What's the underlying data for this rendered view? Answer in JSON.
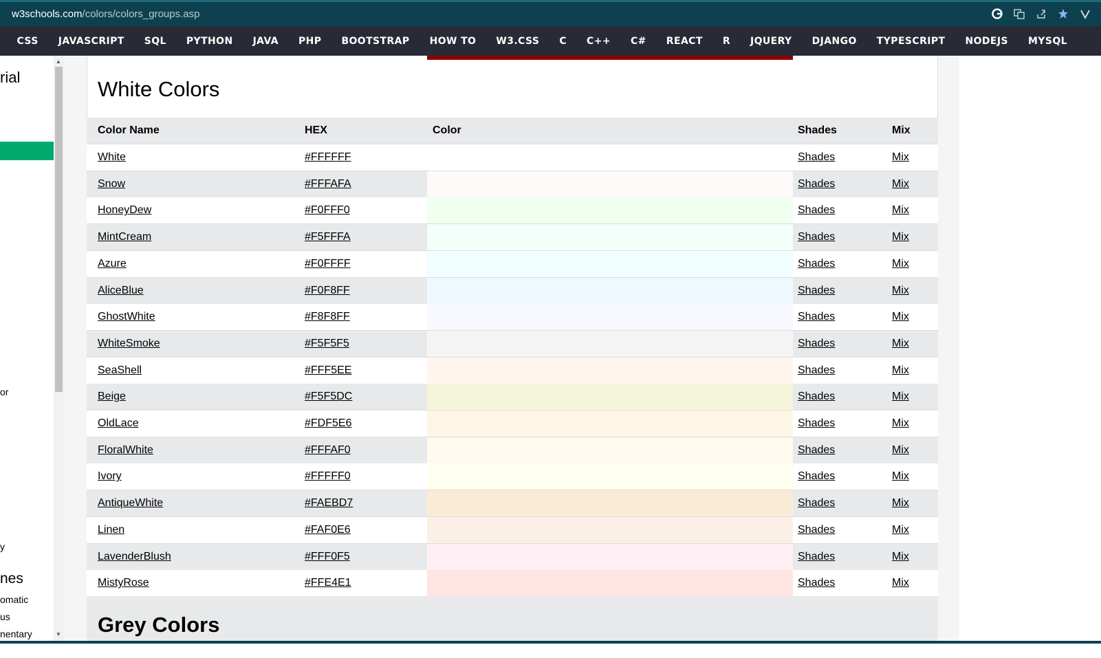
{
  "browser": {
    "url_domain": "w3schools.com",
    "url_path": "/colors/colors_groups.asp"
  },
  "topnav": {
    "items": [
      "CSS",
      "JAVASCRIPT",
      "SQL",
      "PYTHON",
      "JAVA",
      "PHP",
      "BOOTSTRAP",
      "HOW TO",
      "W3.CSS",
      "C",
      "C++",
      "C#",
      "REACT",
      "R",
      "JQUERY",
      "DJANGO",
      "TYPESCRIPT",
      "NODEJS",
      "MYSQL"
    ]
  },
  "sidebar": {
    "fragments": [
      "rial",
      "or",
      "y",
      "nes",
      "omatic",
      "us",
      "nentary"
    ]
  },
  "section": {
    "title": "White Colors",
    "next_title": "Grey Colors"
  },
  "table": {
    "headers": [
      "Color Name",
      "HEX",
      "Color",
      "Shades",
      "Mix"
    ],
    "rows": [
      {
        "name": "White",
        "hex": "#FFFFFF",
        "shades": "Shades",
        "mix": "Mix"
      },
      {
        "name": "Snow",
        "hex": "#FFFAFA",
        "shades": "Shades",
        "mix": "Mix"
      },
      {
        "name": "HoneyDew",
        "hex": "#F0FFF0",
        "shades": "Shades",
        "mix": "Mix"
      },
      {
        "name": "MintCream",
        "hex": "#F5FFFA",
        "shades": "Shades",
        "mix": "Mix"
      },
      {
        "name": "Azure",
        "hex": "#F0FFFF",
        "shades": "Shades",
        "mix": "Mix"
      },
      {
        "name": "AliceBlue",
        "hex": "#F0F8FF",
        "shades": "Shades",
        "mix": "Mix"
      },
      {
        "name": "GhostWhite",
        "hex": "#F8F8FF",
        "shades": "Shades",
        "mix": "Mix"
      },
      {
        "name": "WhiteSmoke",
        "hex": "#F5F5F5",
        "shades": "Shades",
        "mix": "Mix"
      },
      {
        "name": "SeaShell",
        "hex": "#FFF5EE",
        "shades": "Shades",
        "mix": "Mix"
      },
      {
        "name": "Beige",
        "hex": "#F5F5DC",
        "shades": "Shades",
        "mix": "Mix"
      },
      {
        "name": "OldLace",
        "hex": "#FDF5E6",
        "shades": "Shades",
        "mix": "Mix"
      },
      {
        "name": "FloralWhite",
        "hex": "#FFFAF0",
        "shades": "Shades",
        "mix": "Mix"
      },
      {
        "name": "Ivory",
        "hex": "#FFFFF0",
        "shades": "Shades",
        "mix": "Mix"
      },
      {
        "name": "AntiqueWhite",
        "hex": "#FAEBD7",
        "shades": "Shades",
        "mix": "Mix"
      },
      {
        "name": "Linen",
        "hex": "#FAF0E6",
        "shades": "Shades",
        "mix": "Mix"
      },
      {
        "name": "LavenderBlush",
        "hex": "#FFF0F5",
        "shades": "Shades",
        "mix": "Mix"
      },
      {
        "name": "MistyRose",
        "hex": "#FFE4E1",
        "shades": "Shades",
        "mix": "Mix"
      }
    ]
  },
  "colors": {
    "nav_bg": "#282a35",
    "accent": "#04aa6d",
    "address_bg": "#0e4150",
    "strip": "#8b0000"
  }
}
